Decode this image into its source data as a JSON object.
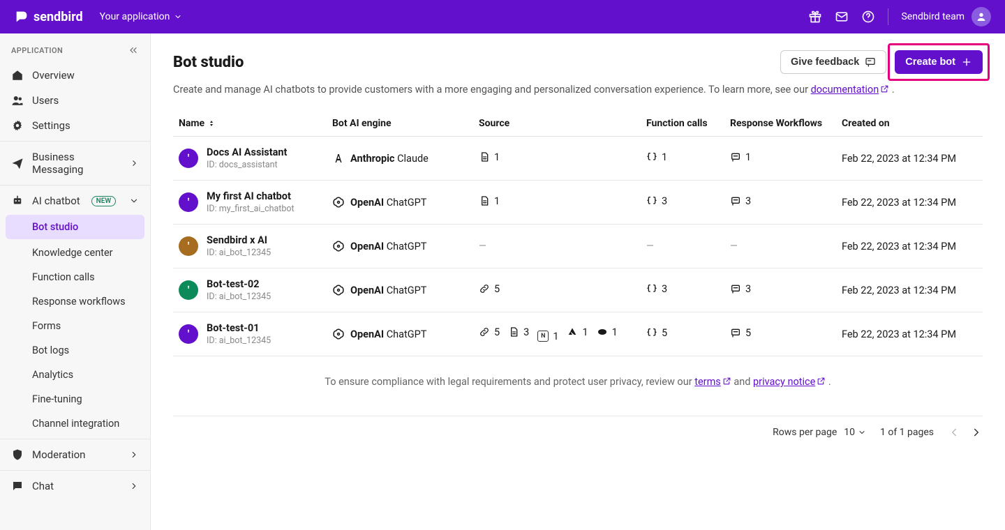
{
  "topbar": {
    "brand": "sendbird",
    "app_switcher": "Your application",
    "team_name": "Sendbird team"
  },
  "sidebar": {
    "section_label": "APPLICATION",
    "items": [
      {
        "label": "Overview",
        "icon": "home"
      },
      {
        "label": "Users",
        "icon": "users"
      },
      {
        "label": "Settings",
        "icon": "gear"
      }
    ],
    "business": {
      "label": "Business Messaging"
    },
    "ai": {
      "label": "AI chatbot",
      "badge": "NEW",
      "children": [
        {
          "label": "Bot studio",
          "active": true
        },
        {
          "label": "Knowledge center"
        },
        {
          "label": "Function calls"
        },
        {
          "label": "Response workflows"
        },
        {
          "label": "Forms"
        },
        {
          "label": "Bot logs"
        },
        {
          "label": "Analytics"
        },
        {
          "label": "Fine-tuning"
        },
        {
          "label": "Channel integration"
        }
      ]
    },
    "moderation": {
      "label": "Moderation"
    },
    "chat": {
      "label": "Chat"
    }
  },
  "page": {
    "title": "Bot studio",
    "feedback_label": "Give feedback",
    "create_label": "Create bot",
    "desc_pre": "Create and manage AI chatbots to provide customers with a more engaging and personalized conversation experience. To learn more, see our ",
    "desc_link": "documentation",
    "desc_post": " ."
  },
  "table": {
    "headers": {
      "name": "Name",
      "engine": "Bot AI engine",
      "source": "Source",
      "functions": "Function calls",
      "workflows": "Response Workflows",
      "created": "Created on"
    },
    "rows": [
      {
        "name": "Docs AI Assistant",
        "id_label": "ID: docs_assistant",
        "avatar_color": "#6210cc",
        "engine_vendor": "Anthropic",
        "engine_model": "Claude",
        "engine_icon": "anthropic",
        "sources": [
          {
            "type": "doc",
            "count": "1"
          }
        ],
        "functions": "1",
        "workflows": "1",
        "created": "Feb 22, 2023 at 12:34 PM"
      },
      {
        "name": "My first AI chatbot",
        "id_label": "ID: my_first_ai_chatbot",
        "avatar_color": "#6210cc",
        "engine_vendor": "OpenAI",
        "engine_model": "ChatGPT",
        "engine_icon": "openai",
        "sources": [
          {
            "type": "doc",
            "count": "1"
          }
        ],
        "functions": "3",
        "workflows": "3",
        "created": "Feb 22, 2023 at 12:34 PM"
      },
      {
        "name": "Sendbird x AI",
        "id_label": "ID: ai_bot_12345",
        "avatar_color": "#a66c1f",
        "engine_vendor": "OpenAI",
        "engine_model": "ChatGPT",
        "engine_icon": "openai",
        "sources": [],
        "functions": "",
        "workflows": "",
        "created": "Feb 22, 2023 at 12:34 PM"
      },
      {
        "name": "Bot-test-02",
        "id_label": "ID: ai_bot_12345",
        "avatar_color": "#0d8a5a",
        "engine_vendor": "OpenAI",
        "engine_model": "ChatGPT",
        "engine_icon": "openai",
        "sources": [
          {
            "type": "link",
            "count": "5"
          }
        ],
        "functions": "3",
        "workflows": "3",
        "created": "Feb 22, 2023 at 12:34 PM"
      },
      {
        "name": "Bot-test-01",
        "id_label": "ID: ai_bot_12345",
        "avatar_color": "#6210cc",
        "engine_vendor": "OpenAI",
        "engine_model": "ChatGPT",
        "engine_icon": "openai",
        "sources": [
          {
            "type": "link",
            "count": "5"
          },
          {
            "type": "doc",
            "count": "3"
          },
          {
            "type": "notion",
            "count": "1"
          },
          {
            "type": "gdrive",
            "count": "1"
          },
          {
            "type": "salesforce",
            "count": "1"
          }
        ],
        "functions": "5",
        "workflows": "5",
        "created": "Feb 22, 2023 at 12:34 PM"
      }
    ]
  },
  "compliance": {
    "pre": "To ensure compliance with legal requirements and protect user privacy, review our ",
    "terms": "terms",
    "mid": "  and ",
    "privacy": "privacy notice",
    "post": " ."
  },
  "pager": {
    "rpp_label": "Rows per page",
    "rpp_value": "10",
    "page_text": "1 of 1 pages"
  }
}
